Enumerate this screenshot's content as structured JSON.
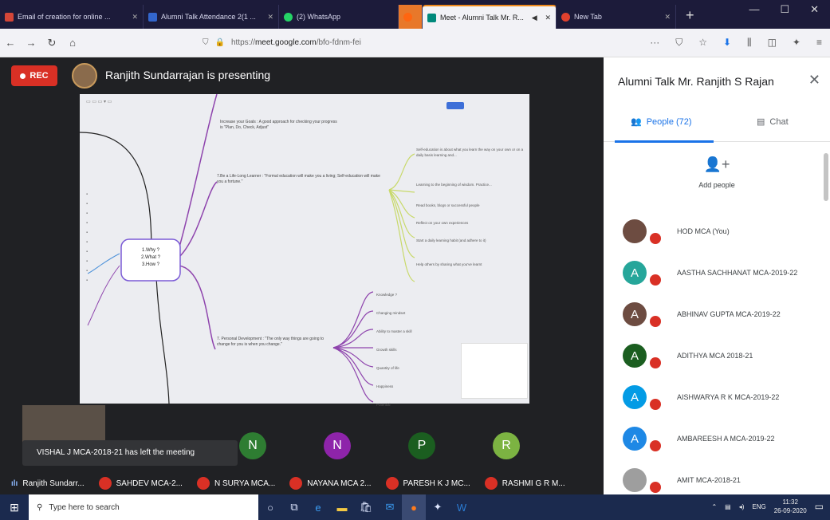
{
  "tabs": [
    {
      "label": "Email of creation for online ...",
      "color": "#d44638"
    },
    {
      "label": "Alumni Talk Attendance 2(1 ...",
      "color": "#3366cc"
    },
    {
      "label": "(2) WhatsApp",
      "color": "#25d366"
    },
    {
      "label": "Meet - Alumni Talk Mr. R...",
      "color": "#00897b"
    },
    {
      "label": "New Tab",
      "color": "#e0412e"
    }
  ],
  "nav": {
    "url_prefix": "https://",
    "url_domain": "meet.google.com",
    "url_path": "/bfo-fdnm-fei"
  },
  "meeting": {
    "rec": "REC",
    "presenting": "Ranjith Sundarrajan is presenting"
  },
  "toast": "VISHAL J MCA-2018-21 has left the meeting",
  "tiles": [
    {
      "letter": "N",
      "color": "#2e7d32"
    },
    {
      "letter": "N",
      "color": "#8e24aa"
    },
    {
      "letter": "P",
      "color": "#1b5e20"
    },
    {
      "letter": "R",
      "color": "#7cb342"
    }
  ],
  "namebar": [
    {
      "name": "Ranjith Sundarr..."
    },
    {
      "name": "SAHDEV MCA-2..."
    },
    {
      "name": "N SURYA MCA..."
    },
    {
      "name": "NAYANA MCA 2..."
    },
    {
      "name": "PARESH K J MC..."
    },
    {
      "name": "RASHMI G R M..."
    }
  ],
  "panel": {
    "title": "Alumni Talk Mr. Ranjith S Rajan",
    "people_tab": "People (72)",
    "chat_tab": "Chat",
    "add_people": "Add people",
    "people": [
      {
        "name": "HOD MCA (You)",
        "letter": "",
        "color": "#6d4c41"
      },
      {
        "name": "AASTHA SACHHANAT MCA-2019-22",
        "letter": "A",
        "color": "#26a69a"
      },
      {
        "name": "ABHINAV GUPTA MCA-2019-22",
        "letter": "A",
        "color": "#6d4c41"
      },
      {
        "name": "ADITHYA MCA 2018-21",
        "letter": "A",
        "color": "#1b5e20"
      },
      {
        "name": "AISHWARYA R K MCA-2019-22",
        "letter": "A",
        "color": "#039be5"
      },
      {
        "name": "AMBAREESH A MCA-2019-22",
        "letter": "A",
        "color": "#1e88e5"
      },
      {
        "name": "AMIT MCA-2018-21",
        "letter": "",
        "color": "#9e9e9e"
      }
    ]
  },
  "taskbar": {
    "search": "Type here to search",
    "lang": "ENG",
    "time": "11:32",
    "date": "26-09-2020"
  },
  "mindmap": {
    "center": [
      "1.Why ?",
      "2.What ?",
      "3.How ?"
    ],
    "left_nodes": [
      "Increase your Goals : A good approach for checking your progress is \"Plan, Do, Check, Adjust\"",
      "7.Be a Life-Long Learner : \"Formal education will make you a living; Self-education will make you a fortune.\"",
      "7. Personal Development : \"The only way things are going to change for you is when you change.\""
    ],
    "right_top": [
      "Self-education is about what you learn the way on your own or on a daily basis learning and...",
      "Learning to the beginning of wisdom. Practice...",
      "Read books, blogs or successful people",
      "Reflect on your own experiences",
      "Start a daily learning habit (and adhere to it)",
      "Help others by sharing what you've learnt"
    ],
    "right_bottom": [
      "Knowledge ?",
      "Changing mindset",
      "Ability to master a skill",
      "Growth skills",
      "Quantity of life",
      "Happiness",
      "Potential"
    ]
  }
}
